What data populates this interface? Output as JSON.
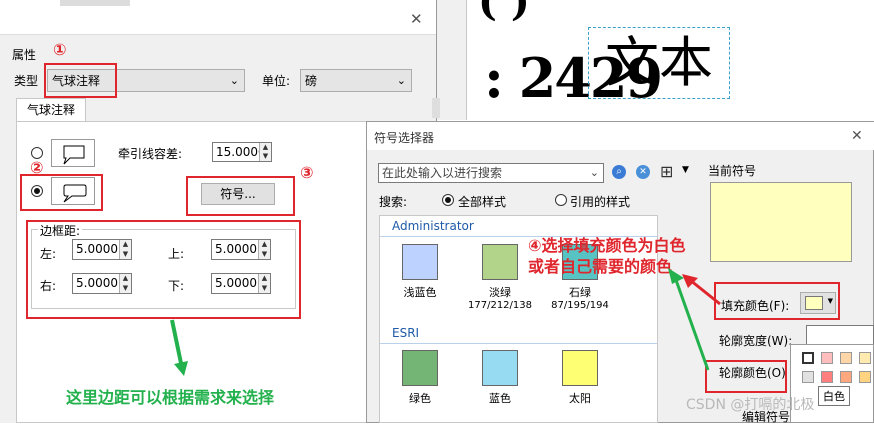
{
  "background_doc": {
    "big_number": ": 2429",
    "top_glyph": "(  )",
    "sample_text": "文本"
  },
  "left_dialog": {
    "title_partial": "属性",
    "properties_label": "属性",
    "type_label": "类型",
    "type_value": "气球注释",
    "unit_label": "单位:",
    "unit_value": "磅",
    "tab_label": "气球注释",
    "leader_tolerance_label": "牵引线容差:",
    "leader_tolerance_value": "15.0000",
    "symbol_button": "符号...",
    "margin_group": "边框距:",
    "left_label": "左:",
    "left_value": "5.0000",
    "top_label": "上:",
    "top_value": "5.0000",
    "right_label": "右:",
    "right_value": "5.0000",
    "bottom_label": "下:",
    "bottom_value": "5.0000"
  },
  "symbol_dialog": {
    "title": "符号选择器",
    "search_placeholder": "在此处输入以进行搜索",
    "search_label": "搜索:",
    "all_styles": "全部样式",
    "referenced_styles": "引用的样式",
    "current_symbol_label": "当前符号",
    "groups": [
      {
        "name": "Administrator",
        "items": [
          {
            "name": "浅蓝色",
            "sub": "",
            "color": "#bed2ff"
          },
          {
            "name": "淡绿",
            "sub": "177/212/138",
            "color": "#b1d48a"
          },
          {
            "name": "石绿",
            "sub": "87/195/194",
            "color": "#57c3c2"
          }
        ]
      },
      {
        "name": "ESRI",
        "items": [
          {
            "name": "绿色",
            "sub": "",
            "color": "#74b474"
          },
          {
            "name": "蓝色",
            "sub": "",
            "color": "#97dbf2"
          },
          {
            "name": "太阳",
            "sub": "",
            "color": "#ffff73"
          }
        ]
      }
    ],
    "fill_color_label": "填充颜色(F):",
    "outline_width_label": "轮廓宽度(W):",
    "outline_color_label": "轮廓颜色(O)",
    "edit_symbol_label": "编辑符号(",
    "tooltip": "白色",
    "current_fill": "#ffffbe"
  },
  "annotations": {
    "n1": "①",
    "n2": "②",
    "n3": "③",
    "step4_line1": "④选择填充颜色为白色",
    "step4_line2": "或者自己需要的颜色",
    "margin_note": "这里边距可以根据需求来选择"
  },
  "watermark": "CSDN @打嗝的北极"
}
